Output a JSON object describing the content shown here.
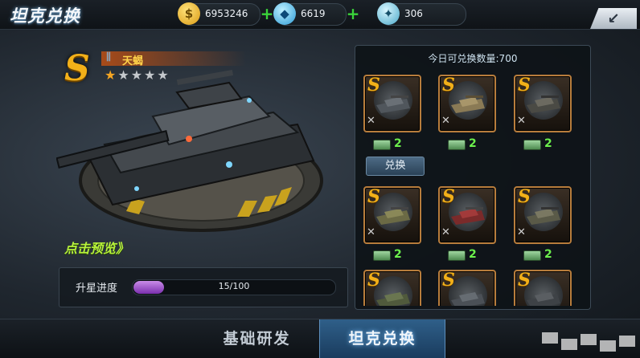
{
  "header": {
    "title": "坦克兑换",
    "back_icon": "back-arrow-icon"
  },
  "resources": [
    {
      "name": "gold",
      "icon": "gold-coin-icon",
      "value": "6953246"
    },
    {
      "name": "gems",
      "icon": "diamond-icon",
      "value": "6619"
    },
    {
      "name": "crystal",
      "icon": "crystal-icon",
      "value": "306"
    }
  ],
  "tank": {
    "rank": "S",
    "name": "天蝎",
    "stars_filled": 1,
    "stars_total": 5
  },
  "preview_label": "点击预览》",
  "progress": {
    "label": "升星进度",
    "current": 15,
    "max": 100,
    "text": "15/100"
  },
  "exchange_panel": {
    "quota_text": "今日可兑换数量:700",
    "button_label": "兑换",
    "items": [
      {
        "rank": "S",
        "cost": "2"
      },
      {
        "rank": "S",
        "cost": "2"
      },
      {
        "rank": "S",
        "cost": "2"
      },
      {
        "rank": "S",
        "cost": "2"
      },
      {
        "rank": "S",
        "cost": "2"
      },
      {
        "rank": "S",
        "cost": "2"
      },
      {
        "rank": "S"
      },
      {
        "rank": "S"
      },
      {
        "rank": "S"
      }
    ]
  },
  "tabs": [
    {
      "label": "基础研发",
      "active": false
    },
    {
      "label": "坦克兑换",
      "active": true
    }
  ],
  "colors": {
    "gold": "#f2b019",
    "accent_green": "#6cf04c",
    "progress_fill": "#9b4fd0",
    "active_tab": "#2f5f89"
  }
}
